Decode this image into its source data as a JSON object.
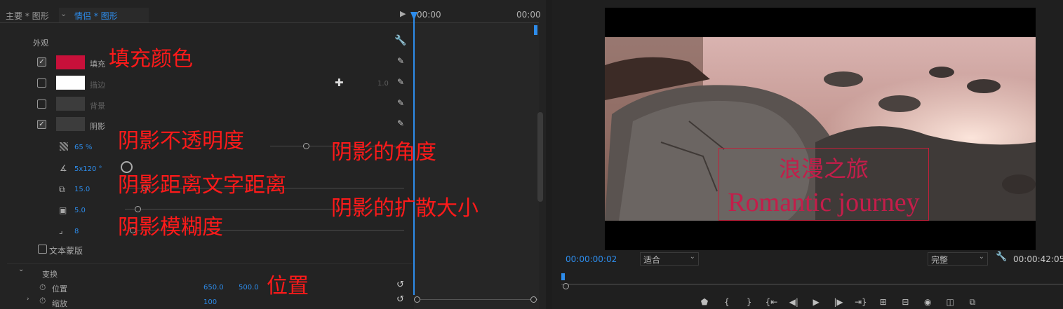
{
  "tabs": {
    "main": "主要 * 图形",
    "active": "情侣 * 图形"
  },
  "timeline": {
    "time_start": "00:00",
    "time_end": "00:00"
  },
  "appearance": {
    "section_title": "外观",
    "fill": {
      "label": "填充",
      "checked": true,
      "color": "#c8103a"
    },
    "stroke": {
      "label": "描边",
      "checked": false,
      "color": "#ffffff",
      "width": "1.0"
    },
    "background": {
      "label": "背景",
      "checked": false
    },
    "shadow": {
      "label": "阴影",
      "checked": true
    },
    "shadow_opacity": "65 %",
    "shadow_angle": "5x120 °",
    "shadow_distance": "15.0",
    "shadow_size": "5.0",
    "shadow_blur": "8",
    "text_mask": "文本蒙版"
  },
  "transform": {
    "section_title": "变换",
    "position_label": "位置",
    "position_x": "650.0",
    "position_y": "500.0",
    "scale_label": "缩放",
    "scale_value": "100"
  },
  "annotations": {
    "fill_color": "填充颜色",
    "shadow_opacity": "阴影不透明度",
    "shadow_angle": "阴影的角度",
    "shadow_distance": "阴影距离文字距离",
    "shadow_spread": "阴影的扩散大小",
    "shadow_blur": "阴影模糊度",
    "position": "位置"
  },
  "program": {
    "title_cn": "浪漫之旅",
    "title_en": "Romantic journey",
    "timecode": "00:00:00:02",
    "fit": "适合",
    "quality": "完整",
    "duration": "00:00:42:05"
  },
  "colors": {
    "accent": "#2d8ceb",
    "annotation": "#ff1a1a",
    "title_text": "#c41d4a"
  }
}
